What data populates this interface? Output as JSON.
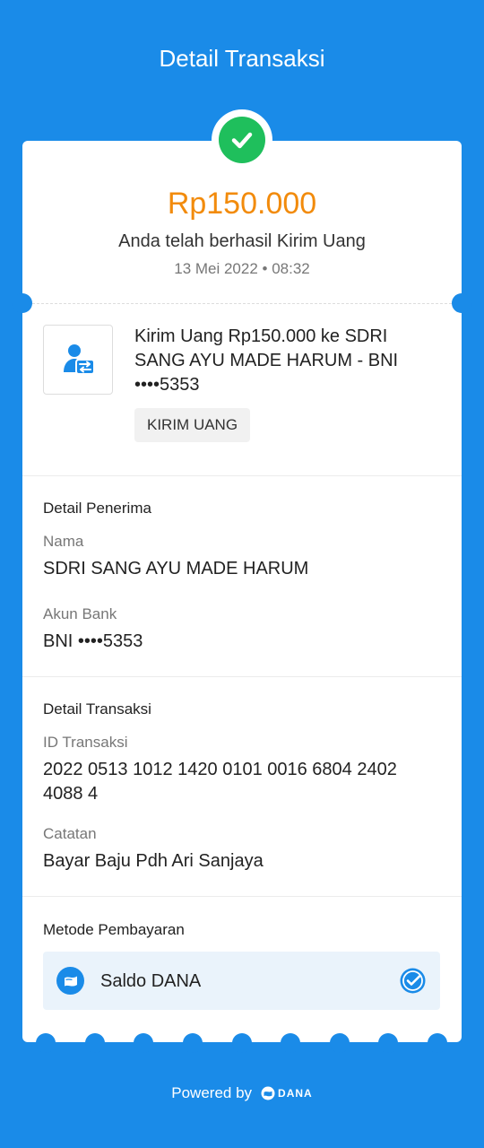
{
  "header": {
    "title": "Detail Transaksi"
  },
  "summary": {
    "amount": "Rp150.000",
    "status": "Anda telah berhasil Kirim Uang",
    "datetime": "13 Mei 2022 • 08:32"
  },
  "transaction": {
    "icon": "transfer-person-icon",
    "description": "Kirim Uang Rp150.000 ke SDRI SANG AYU MADE HARUM - BNI ••••5353",
    "tag": "KIRIM UANG"
  },
  "recipient": {
    "section_title": "Detail Penerima",
    "name_label": "Nama",
    "name_value": "SDRI SANG AYU MADE HARUM",
    "bank_label": "Akun Bank",
    "bank_value": "BNI ••••5353"
  },
  "details": {
    "section_title": "Detail Transaksi",
    "id_label": "ID Transaksi",
    "id_value": "2022 0513 1012 1420 0101 0016 6804 2402 4088 4",
    "note_label": "Catatan",
    "note_value": "Bayar Baju Pdh Ari Sanjaya"
  },
  "payment": {
    "section_title": "Metode Pembayaran",
    "method": "Saldo DANA",
    "icon": "wallet-icon",
    "selected_icon": "check-badge-icon"
  },
  "footer": {
    "powered_by": "Powered by",
    "brand": "DANA"
  },
  "colors": {
    "background": "#1a8be8",
    "amount": "#f28b0c",
    "success": "#1fbf5c",
    "card": "#ffffff",
    "payment_box": "#eaf3fb"
  }
}
